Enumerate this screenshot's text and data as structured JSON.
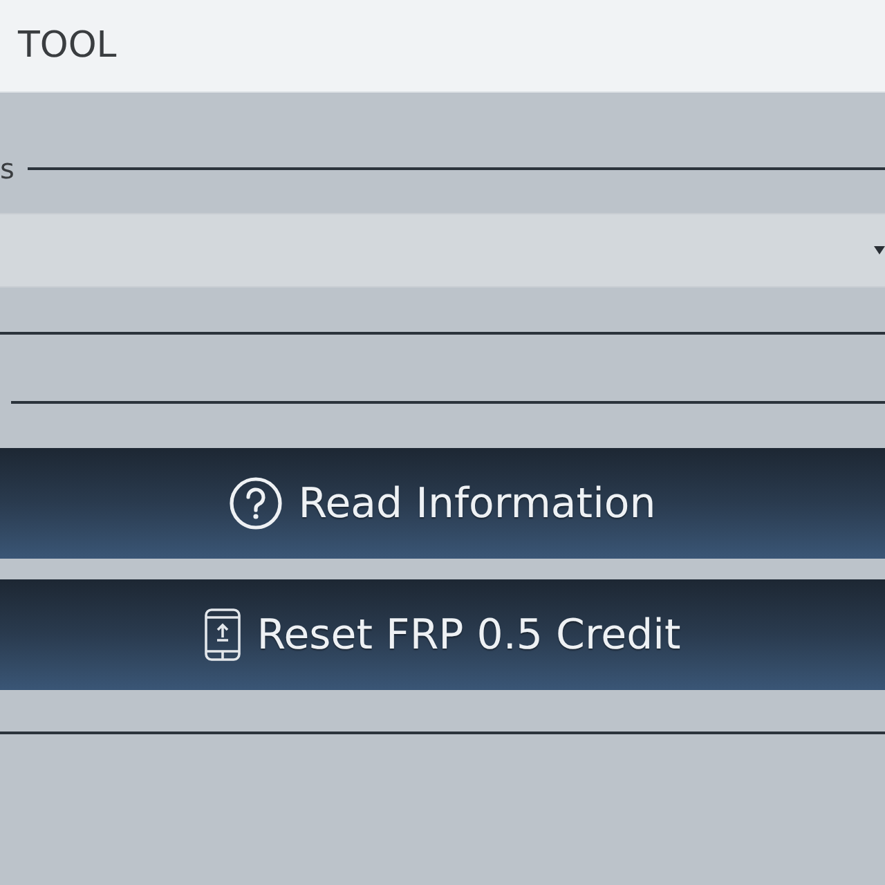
{
  "window": {
    "title": "TOOL"
  },
  "group_1": {
    "legend": "s",
    "controls": [
      {
        "kind": "dropdown"
      }
    ]
  },
  "group_2": {
    "buttons": [
      {
        "label": "Read Information"
      },
      {
        "label": "Reset FRP 0.5 Credit"
      }
    ]
  }
}
